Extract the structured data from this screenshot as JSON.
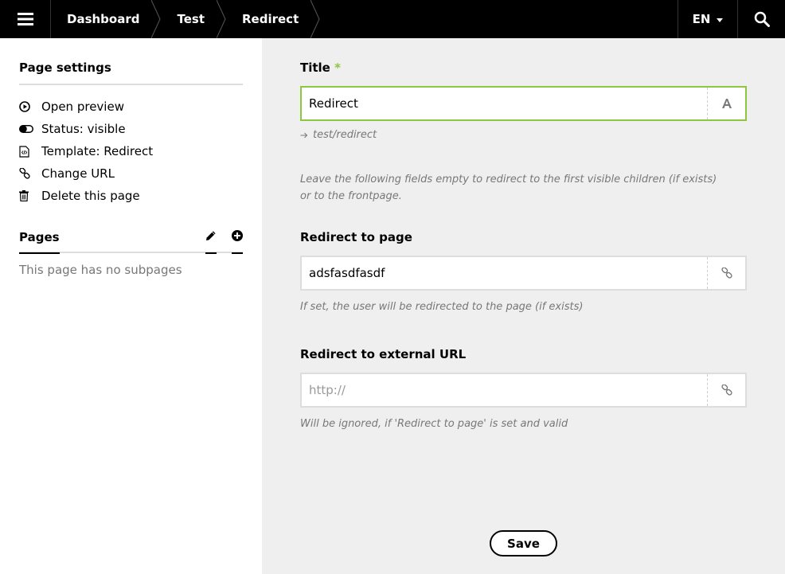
{
  "topbar": {
    "menu_icon": "hamburger-icon",
    "breadcrumbs": [
      {
        "label": "Dashboard"
      },
      {
        "label": "Test"
      },
      {
        "label": "Redirect"
      }
    ],
    "language": "EN",
    "search_icon": "search-icon"
  },
  "sidebar": {
    "settings_heading": "Page settings",
    "items": [
      {
        "label": "Open preview",
        "icon": "play-circle-icon"
      },
      {
        "label": "Status: visible",
        "icon": "toggle-icon"
      },
      {
        "label": "Template: Redirect",
        "icon": "code-file-icon"
      },
      {
        "label": "Change URL",
        "icon": "link-icon"
      },
      {
        "label": "Delete this page",
        "icon": "trash-icon"
      }
    ],
    "pages_heading": "Pages",
    "no_subpages": "This page has no subpages"
  },
  "main": {
    "title_label": "Title",
    "required_mark": "*",
    "title_value": "Redirect",
    "slug": "test/redirect",
    "info_text": "Leave the following fields empty to redirect to the first visible children (if exists) or to the frontpage.",
    "redirect_page_label": "Redirect to page",
    "redirect_page_value": "adsfasdfasdf",
    "redirect_page_help": "If set, the user will be redirected to the page (if exists)",
    "redirect_url_label": "Redirect to external URL",
    "redirect_url_placeholder": "http://",
    "redirect_url_help": "Will be ignored, if 'Redirect to page' is set and valid",
    "save_label": "Save"
  },
  "colors": {
    "accent": "#8dc63f",
    "topbar": "#000000",
    "panel": "#efefef"
  }
}
